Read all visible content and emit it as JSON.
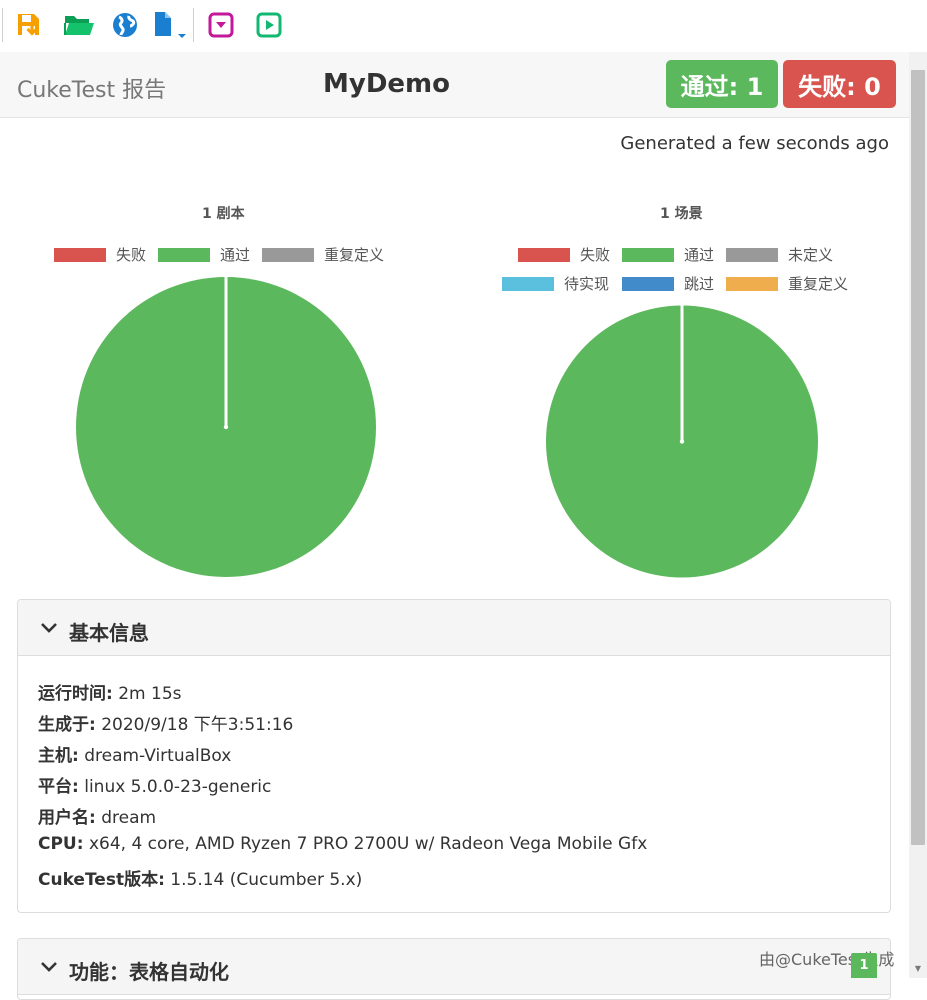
{
  "toolbar": {
    "icons": [
      "save-export-icon",
      "open-folder-icon",
      "globe-icon",
      "new-file-dropdown-icon",
      "collapse-icon",
      "run-icon"
    ]
  },
  "header": {
    "brand": "CukeTest 报告",
    "project_title": "MyDemo",
    "pass_badge": "通过: 1",
    "fail_badge": "失败: 0"
  },
  "generated": "Generated a few seconds ago",
  "colors": {
    "failed": "#d9534f",
    "passed": "#5cb85c",
    "ambiguous_gray": "#999999",
    "pending": "#5bc0de",
    "skipped": "#428bca",
    "ambiguous_orange": "#f0ad4e"
  },
  "charts": [
    {
      "title": "1 剧本",
      "legend": [
        "失败",
        "通过",
        "重复定义"
      ],
      "chart_data": {
        "type": "pie",
        "categories": [
          "失败",
          "通过",
          "重复定义"
        ],
        "values": [
          0,
          1,
          0
        ]
      }
    },
    {
      "title": "1 场景",
      "legend": [
        "失败",
        "通过",
        "未定义",
        "待实现",
        "跳过",
        "重复定义"
      ],
      "chart_data": {
        "type": "pie",
        "categories": [
          "失败",
          "通过",
          "未定义",
          "待实现",
          "跳过",
          "重复定义"
        ],
        "values": [
          0,
          1,
          0,
          0,
          0,
          0
        ]
      }
    }
  ],
  "basic_info": {
    "title": "基本信息",
    "rows": [
      {
        "label": "运行时间:",
        "value": "2m 15s"
      },
      {
        "label": "生成于:",
        "value": "2020/9/18 下午3:51:16"
      },
      {
        "label": "主机:",
        "value": "dream-VirtualBox"
      },
      {
        "label": "平台:",
        "value": "linux 5.0.0-23-generic"
      },
      {
        "label": "用户名:",
        "value": "dream"
      },
      {
        "label": "CPU:",
        "value": "x64, 4 core, AMD Ryzen 7 PRO 2700U w/ Radeon Vega Mobile Gfx"
      },
      {
        "label": "CukeTest版本:",
        "value": "1.5.14 (Cucumber 5.x)"
      }
    ]
  },
  "feature_panel": {
    "title": "功能：表格自动化"
  },
  "watermark": "由@CukeTest生成",
  "floating_badge": "1"
}
